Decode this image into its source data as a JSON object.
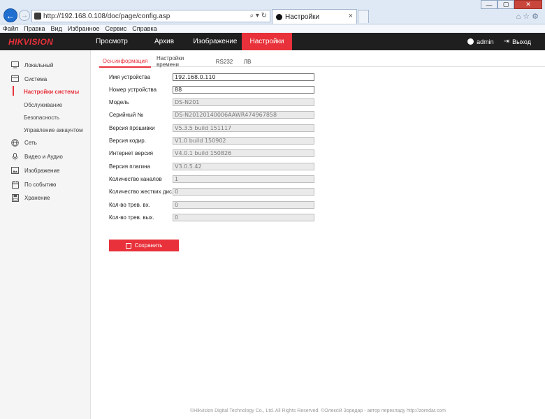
{
  "browser": {
    "url": "http://192.168.0.108/doc/page/config.asp",
    "address_controls": "⌕ ▾ ↻",
    "tab_title": "Настройки",
    "tab_close": "×",
    "win_min": "—",
    "win_max": "▢",
    "win_close": "✕",
    "toolbar_icons": "⌂☆⚙"
  },
  "menubar": [
    "Файл",
    "Правка",
    "Вид",
    "Избранное",
    "Сервис",
    "Справка"
  ],
  "header": {
    "logo": "HIKVISION",
    "tabs": [
      "Просмотр",
      "Архив",
      "Изображение",
      "Настройки"
    ],
    "active_tab": "Настройки",
    "user": "admin",
    "logout": "Выход",
    "accent_color": "#e8313a"
  },
  "sidebar": {
    "items": [
      {
        "label": "Локальный",
        "icon": "monitor-icon"
      },
      {
        "label": "Система",
        "icon": "system-icon"
      },
      {
        "label": "Настройки системы",
        "sub": true,
        "active": true
      },
      {
        "label": "Обслуживание",
        "sub": true
      },
      {
        "label": "Безопасность",
        "sub": true
      },
      {
        "label": "Управление аккаунтом",
        "sub": true
      },
      {
        "label": "Сеть",
        "icon": "globe-icon"
      },
      {
        "label": "Видео и Аудио",
        "icon": "microphone-icon"
      },
      {
        "label": "Изображение",
        "icon": "image-icon"
      },
      {
        "label": "По событию",
        "icon": "calendar-icon"
      },
      {
        "label": "Хранение",
        "icon": "storage-icon"
      }
    ]
  },
  "subtabs": [
    "Осн.информация",
    "Настройки времени",
    "RS232",
    "ЛВ"
  ],
  "form": {
    "rows": [
      {
        "label": "Имя устройства",
        "value": "192.168.0.110",
        "editable": true
      },
      {
        "label": "Номер устройства",
        "value": "88",
        "editable": true
      },
      {
        "label": "Модель",
        "value": "DS-N201"
      },
      {
        "label": "Серийный №",
        "value": "DS-N20120140006AAWR474967858"
      },
      {
        "label": "Версия прошивки",
        "value": "V5.3.5 build 151117"
      },
      {
        "label": "Версия кодир.",
        "value": "V1.0 build 150902"
      },
      {
        "label": "Интернет версия",
        "value": "V4.0.1 build 150826"
      },
      {
        "label": "Версия плагина",
        "value": "V3.0.5.42"
      },
      {
        "label": "Количество каналов",
        "value": "1"
      },
      {
        "label": "Количество жестких дис...",
        "value": "0"
      },
      {
        "label": "Кол-во трев. вх.",
        "value": "0"
      },
      {
        "label": "Кол-во трев. вых.",
        "value": "0"
      }
    ]
  },
  "save_label": "Сохранить",
  "footer": "©Hikvision Digital Technology Co., Ltd. All Rights Reserved. ©Олексій Зоредар - автор перекладу http://zoredar.com"
}
